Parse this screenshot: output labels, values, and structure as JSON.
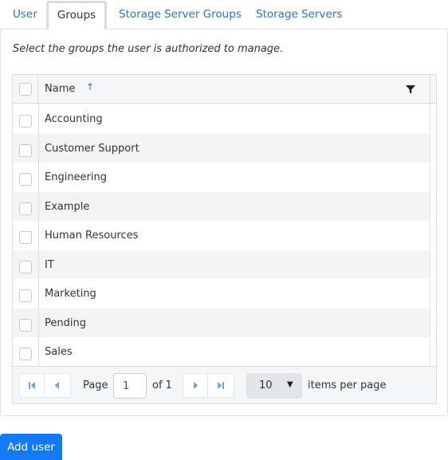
{
  "tabs": [
    {
      "label": "User",
      "active": false
    },
    {
      "label": "Groups",
      "active": true
    },
    {
      "label": "Storage Server Groups",
      "active": false
    },
    {
      "label": "Storage Servers",
      "active": false
    }
  ],
  "panel": {
    "description": "Select the groups the user is authorized to manage."
  },
  "grid": {
    "column_header": "Name",
    "sort": "ascending",
    "sort_icon": "arrow-up-icon",
    "filter_icon": "filter-icon",
    "rows": [
      {
        "name": "Accounting",
        "checked": false
      },
      {
        "name": "Customer Support",
        "checked": false
      },
      {
        "name": "Engineering",
        "checked": false
      },
      {
        "name": "Example",
        "checked": false
      },
      {
        "name": "Human Resources",
        "checked": false
      },
      {
        "name": "IT",
        "checked": false
      },
      {
        "name": "Marketing",
        "checked": false
      },
      {
        "name": "Pending",
        "checked": false
      },
      {
        "name": "Sales",
        "checked": false
      }
    ]
  },
  "pager": {
    "page_label": "Page",
    "current_page": "1",
    "of_label": "of 1",
    "page_size": "10",
    "items_per_page_label": "items per page",
    "icons": {
      "first": "first-page-icon",
      "prev": "prev-page-icon",
      "next": "next-page-icon",
      "last": "last-page-icon"
    }
  },
  "actions": {
    "add_user_label": "Add user"
  },
  "colors": {
    "accent": "#1479f5",
    "link": "#2f72c4",
    "alt_row": "#f4f4f4"
  }
}
